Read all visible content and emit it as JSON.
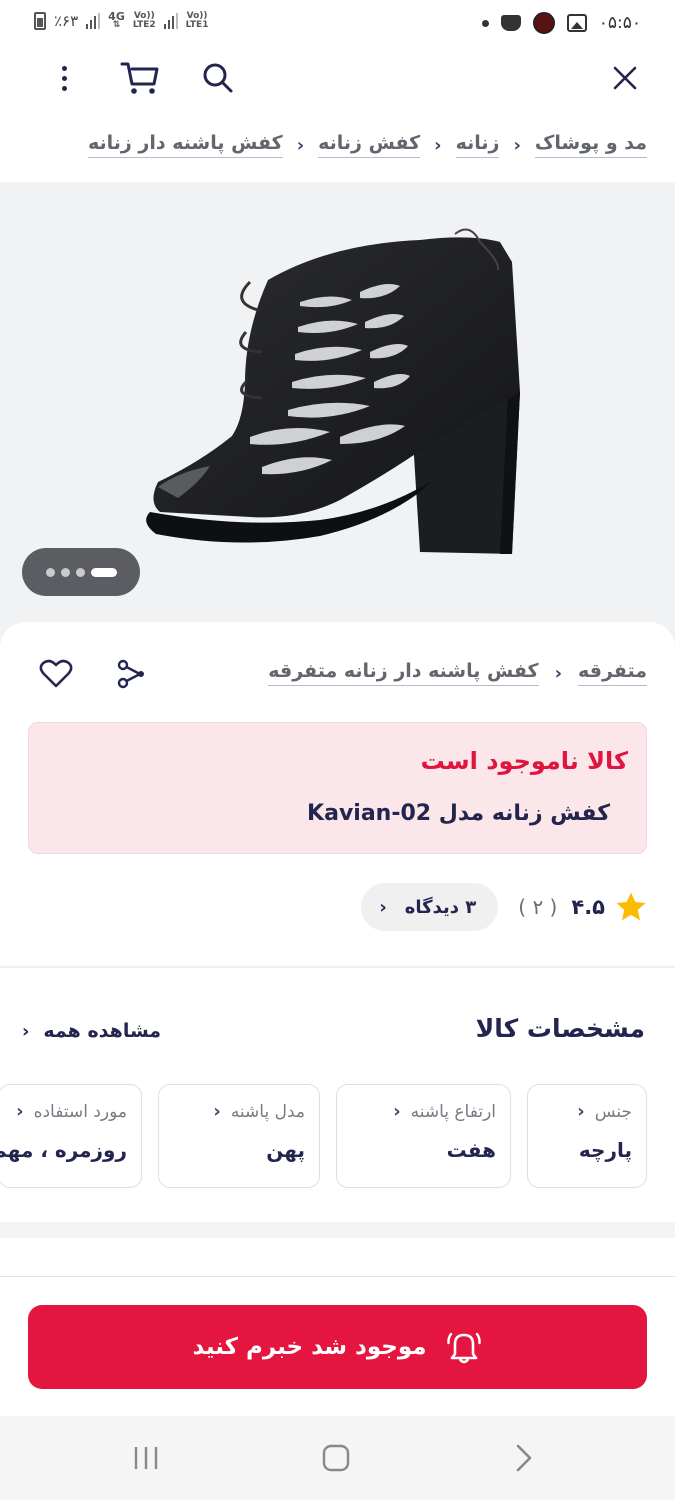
{
  "status_bar": {
    "battery": "٪۶۳",
    "net1": "4G",
    "net1_sub": "LTE2",
    "net2_top": "Vo))",
    "net2": "LTE1",
    "time": "۰۵:۵۰"
  },
  "toolbar": {
    "close_icon": "close-icon",
    "search_icon": "search-icon",
    "cart_icon": "cart-icon",
    "more_icon": "more-vertical-icon"
  },
  "breadcrumb": {
    "items": [
      "مد و پوشاک",
      "زنانه",
      "کفش زنانه",
      "کفش پاشنه دار زنانه"
    ]
  },
  "gallery": {
    "image_alt": "black peep-toe heeled bootie",
    "pages": 4,
    "active_page": 4
  },
  "product": {
    "brand": "متفرقه",
    "category_link": "کفش پاشنه دار زنانه متفرقه",
    "stock_status": "کالا ناموجود است",
    "title": "کفش زنانه مدل Kavian-02",
    "rating": "۴.۵",
    "rating_count": "( ۲ )",
    "reviews_label": "۳ دیدگاه"
  },
  "specs": {
    "title": "مشخصات کالا",
    "see_all": "مشاهده همه",
    "cards": [
      {
        "label": "جنس",
        "value": "پارچه"
      },
      {
        "label": "ارتفاع پاشنه",
        "value": "هفت"
      },
      {
        "label": "مدل پاشنه",
        "value": "پهن"
      },
      {
        "label": "مورد استفاده",
        "value": "روزمره ، مهمانی"
      }
    ]
  },
  "actions": {
    "notify_label": "موجود شد خبرم کنید"
  },
  "colors": {
    "accent": "#e4153f",
    "text": "#23254e",
    "alert_bg": "#fbe6e9",
    "star": "#f9bc00"
  }
}
